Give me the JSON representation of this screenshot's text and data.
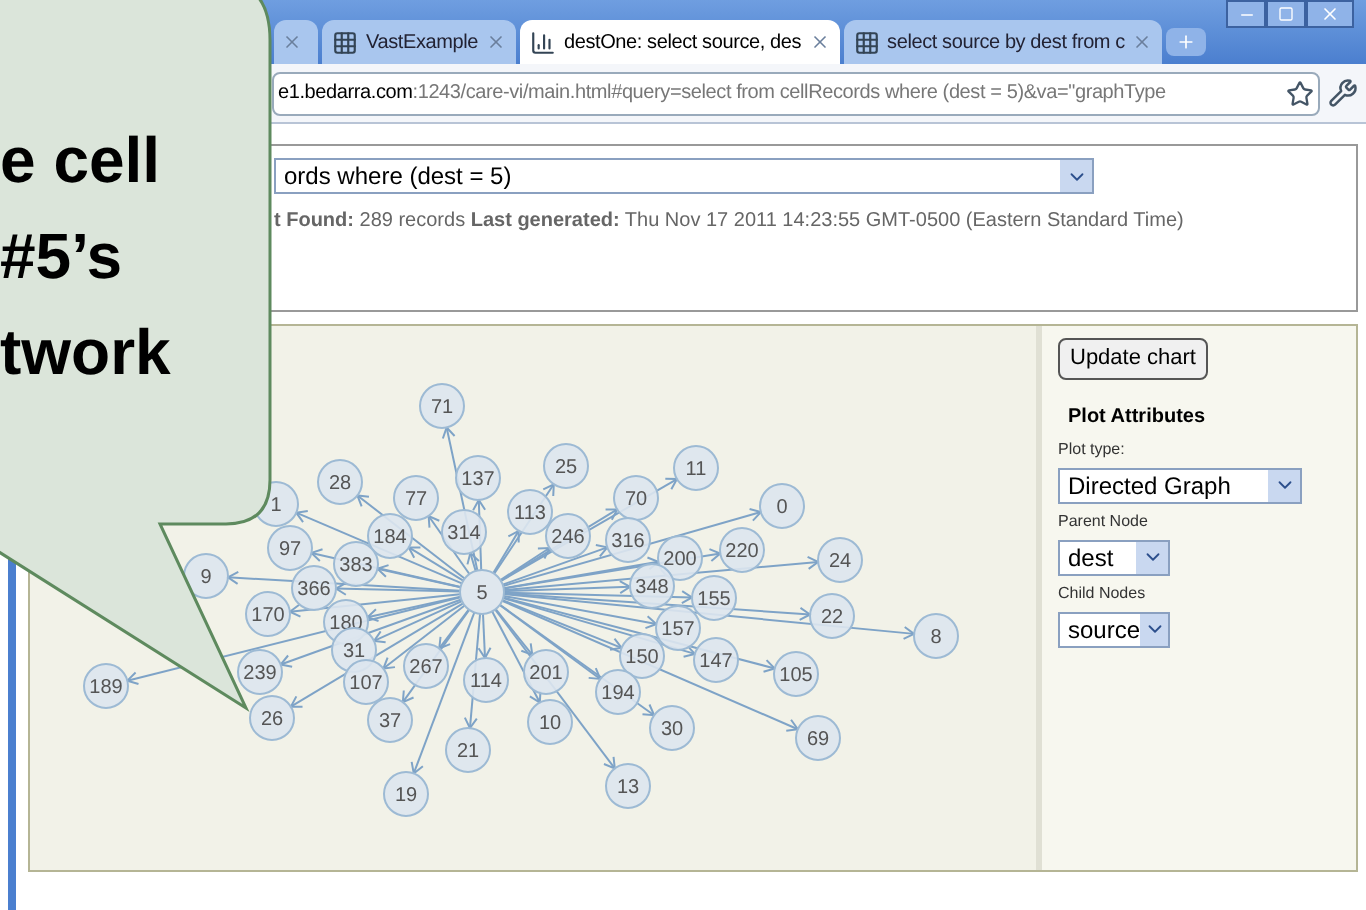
{
  "browser": {
    "tabs": [
      {
        "label": "VastExample",
        "kind": "grid",
        "selected": false
      },
      {
        "label": "destOne: select source, des",
        "kind": "chart",
        "selected": true
      },
      {
        "label": "select source by dest from c",
        "kind": "grid",
        "selected": false
      }
    ],
    "address": {
      "host": "e1.bedarra.com",
      "path": ":1243/care-vi/main.html#query=select from cellRecords where (dest = 5)&va=\"graphType"
    }
  },
  "query": {
    "value": "ords where (dest = 5)",
    "status": "**t Found:** 289 records  **Last generated:** Thu Nov 17 2011 14:23:55 GMT-0500 (Eastern Standard Time)"
  },
  "graph": {
    "parent": "5",
    "children": [
      "71",
      "28",
      "77",
      "137",
      "25",
      "11",
      "1",
      "184",
      "314",
      "113",
      "246",
      "70",
      "316",
      "0",
      "97",
      "383",
      "200",
      "220",
      "24",
      "9",
      "366",
      "348",
      "155",
      "170",
      "180",
      "22",
      "8",
      "157",
      "31",
      "239",
      "267",
      "150",
      "147",
      "201",
      "105",
      "189",
      "107",
      "114",
      "194",
      "26",
      "37",
      "10",
      "30",
      "69",
      "21",
      "13",
      "19"
    ]
  },
  "plot_panel": {
    "button": "Update chart",
    "heading": "Plot Attributes",
    "fields": [
      {
        "label": "Plot type:",
        "value": "Directed Graph"
      },
      {
        "label": "Parent Node",
        "value": "dest"
      },
      {
        "label": "Child Nodes",
        "value": "source"
      }
    ]
  },
  "callout": {
    "text": "e cell\n#5’s\ntwork"
  }
}
